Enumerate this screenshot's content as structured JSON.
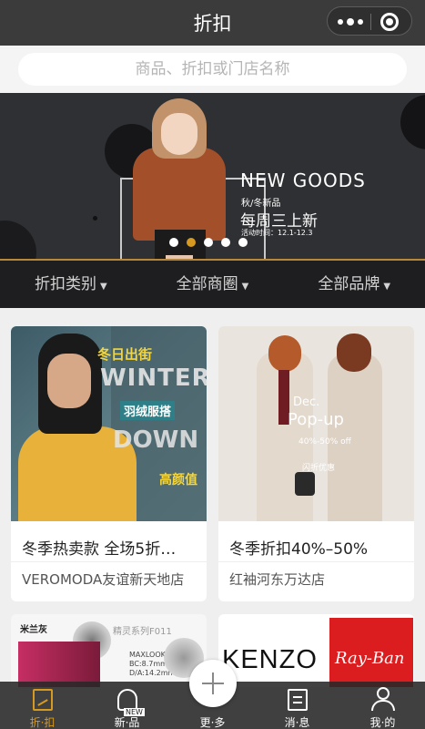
{
  "header": {
    "title": "折扣"
  },
  "search": {
    "placeholder": "商品、折扣或门店名称"
  },
  "banner": {
    "headline": "NEW GOODS",
    "subline": "秋/冬新品",
    "weekly": "每周三上新",
    "time": "活动时间：12.1-12.3",
    "slide_count": 5,
    "active_slide": 2
  },
  "filters": [
    {
      "label": "折扣类别"
    },
    {
      "label": "全部商圈"
    },
    {
      "label": "全部品牌"
    }
  ],
  "cards": [
    {
      "title": "冬季热卖款 全场5折…",
      "store": "VEROMODA友谊新天地店",
      "image_text": {
        "a": "冬日出街",
        "b": "WINTER",
        "c": "羽绒服搭",
        "d": "DOWN",
        "e": "高颜值"
      }
    },
    {
      "title": "冬季折扣40%–50%",
      "store": "红袖河东万达店",
      "image_text": {
        "a": "Dec.",
        "b": "Pop-up",
        "c": "40%-50% off",
        "d": "闪折优惠"
      }
    }
  ],
  "partial_cards": [
    {
      "brand": "米兰灰",
      "series": "精灵系列F011",
      "logo": "MAXLOOK",
      "spec": "BC:8.7mm D/A:14.2mm"
    },
    {
      "brand": "KENZO",
      "brand2": "Ray-Ban"
    }
  ],
  "tabbar": [
    {
      "label": "折·扣",
      "active": true,
      "icon": "discount-icon"
    },
    {
      "label": "新·品",
      "active": false,
      "icon": "new-icon",
      "badge": "NEW"
    },
    {
      "label": "更·多",
      "active": false,
      "icon": "plus-icon"
    },
    {
      "label": "消·息",
      "active": false,
      "icon": "message-icon"
    },
    {
      "label": "我·的",
      "active": false,
      "icon": "user-icon"
    }
  ],
  "colors": {
    "accent": "#d79a21",
    "topbar": "#3b3b3b",
    "banner_bg": "#2f3033"
  }
}
